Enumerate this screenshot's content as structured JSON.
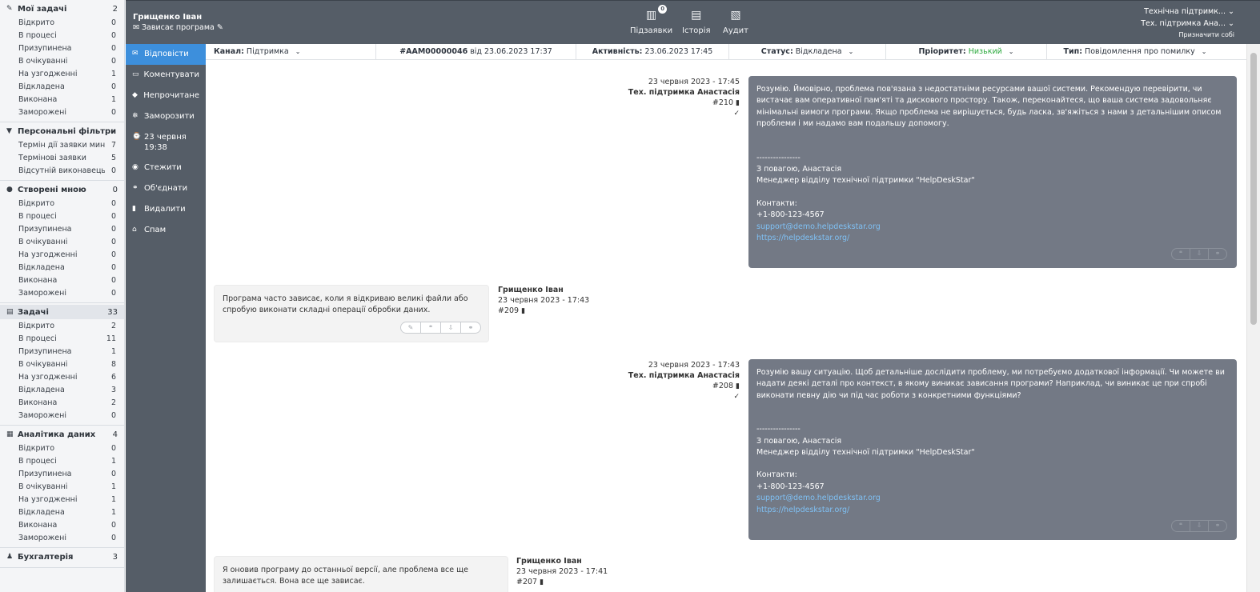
{
  "sidebar": {
    "groups": [
      {
        "icon": "✎",
        "icon_name": "bookmark-icon",
        "title": "Мої задачі",
        "count": "2",
        "active": false,
        "rows": [
          {
            "label": "Відкрито",
            "count": "0"
          },
          {
            "label": "В процесі",
            "count": "0"
          },
          {
            "label": "Призупинена",
            "count": "0"
          },
          {
            "label": "В очікуванні",
            "count": "0"
          },
          {
            "label": "На узгодженні",
            "count": "1"
          },
          {
            "label": "Відкладена",
            "count": "0"
          },
          {
            "label": "Виконана",
            "count": "1"
          },
          {
            "label": "Заморожені",
            "count": "0"
          }
        ]
      },
      {
        "icon": "▼",
        "icon_name": "filter-icon",
        "title": "Персональні фільтри",
        "count": "",
        "active": false,
        "rows": [
          {
            "label": "Термін дії заявки минув",
            "count": "7"
          },
          {
            "label": "Термінові заявки",
            "count": "5"
          },
          {
            "label": "Відсутній виконавець",
            "count": "0"
          }
        ]
      },
      {
        "icon": "●",
        "icon_name": "comment-icon",
        "title": "Створені мною",
        "count": "0",
        "active": false,
        "rows": [
          {
            "label": "Відкрито",
            "count": "0"
          },
          {
            "label": "В процесі",
            "count": "0"
          },
          {
            "label": "Призупинена",
            "count": "0"
          },
          {
            "label": "В очікуванні",
            "count": "0"
          },
          {
            "label": "На узгодженні",
            "count": "0"
          },
          {
            "label": "Відкладена",
            "count": "0"
          },
          {
            "label": "Виконана",
            "count": "0"
          },
          {
            "label": "Заморожені",
            "count": "0"
          }
        ]
      },
      {
        "icon": "▤",
        "icon_name": "clipboard-icon",
        "title": "Задачі",
        "count": "33",
        "active": true,
        "rows": [
          {
            "label": "Відкрито",
            "count": "2"
          },
          {
            "label": "В процесі",
            "count": "11"
          },
          {
            "label": "Призупинена",
            "count": "1"
          },
          {
            "label": "В очікуванні",
            "count": "8"
          },
          {
            "label": "На узгодженні",
            "count": "6"
          },
          {
            "label": "Відкладена",
            "count": "3"
          },
          {
            "label": "Виконана",
            "count": "2"
          },
          {
            "label": "Заморожені",
            "count": "0"
          }
        ]
      },
      {
        "icon": "▦",
        "icon_name": "android-icon",
        "title": "Аналітика даних",
        "count": "4",
        "active": false,
        "rows": [
          {
            "label": "Відкрито",
            "count": "0"
          },
          {
            "label": "В процесі",
            "count": "1"
          },
          {
            "label": "Призупинена",
            "count": "0"
          },
          {
            "label": "В очікуванні",
            "count": "1"
          },
          {
            "label": "На узгодженні",
            "count": "1"
          },
          {
            "label": "Відкладена",
            "count": "1"
          },
          {
            "label": "Виконана",
            "count": "0"
          },
          {
            "label": "Заморожені",
            "count": "0"
          }
        ]
      },
      {
        "icon": "♟",
        "icon_name": "accounting-icon",
        "title": "Бухгалтерія",
        "count": "3",
        "active": false,
        "rows": []
      }
    ]
  },
  "header": {
    "requester": "Грищенко Іван",
    "subject": "Зависає програма",
    "buttons": [
      {
        "label": "Підзаявки",
        "icon": "▥",
        "badge": "0"
      },
      {
        "label": "Історія",
        "icon": "▤",
        "badge": ""
      },
      {
        "label": "Аудит",
        "icon": "▧",
        "badge": ""
      }
    ],
    "group_select": "Технічна підтримк...",
    "assignee_select": "Тех. підтримка Ана...",
    "assign_self": "Призначити собі"
  },
  "actions": [
    {
      "label": "Відповісти",
      "icon": "✉",
      "icon_name": "reply-icon",
      "selected": true
    },
    {
      "label": "Коментувати",
      "icon": "▭",
      "icon_name": "comment-icon",
      "selected": false
    },
    {
      "label": "Непрочитане",
      "icon": "◆",
      "icon_name": "unread-icon",
      "selected": false
    },
    {
      "label": "Заморозити",
      "icon": "❄",
      "icon_name": "snowflake-icon",
      "selected": false
    },
    {
      "label": "23 червня 19:38",
      "icon": "⌚",
      "icon_name": "snooze-icon",
      "selected": false
    },
    {
      "label": "Стежити",
      "icon": "◉",
      "icon_name": "eye-icon",
      "selected": false
    },
    {
      "label": "Об'єднати",
      "icon": "⚭",
      "icon_name": "link-icon",
      "selected": false
    },
    {
      "label": "Видалити",
      "icon": "▮",
      "icon_name": "trash-icon",
      "selected": false
    },
    {
      "label": "Спам",
      "icon": "⌂",
      "icon_name": "spam-icon",
      "selected": false
    }
  ],
  "info": {
    "channel_label": "Канал:",
    "channel_value": "Підтримка",
    "ticket_number": "#AAM00000046",
    "ticket_from": "від 23.06.2023 17:37",
    "activity_label": "Активність:",
    "activity_value": "23.06.2023 17:45",
    "status_label": "Статус:",
    "status_value": "Відкладена",
    "priority_label": "Пріоритет:",
    "priority_value": "Низький",
    "priority_color": "#2eaa3f",
    "type_label": "Тип:",
    "type_value": "Повідомлення про помилку"
  },
  "messages": [
    {
      "agent_time": "23 червня 2023 - 17:45",
      "agent_name": "Тех. підтримка Анастасія",
      "agent_id": "#210",
      "paragraph": "Розумію. Ймовірно, проблема пов'язана з недостатніми ресурсами вашої системи. Рекомендую перевірити, чи вистачає вам оперативної пам'яті та дискового простору. Також, переконайтеся, що ваша система задовольняє мінімальні вимоги програми. Якщо проблема не вирішується, будь ласка, зв'яжіться з нами з детальнішим описом проблеми і ми надамо вам подальшу допомогу.",
      "sep": "----------------",
      "regards": "З повагою, Анастасія",
      "position": "Менеджер відділу технічної підтримки \"HelpDeskStar\"",
      "contacts": "Контакти:",
      "phone": "+1-800-123-4567",
      "email": "support@demo.helpdeskstar.org",
      "site": "https://helpdeskstar.org/"
    },
    {
      "client_text": "Програма часто зависає, коли я відкриваю великі файли або спробую виконати складні операції обробки даних.",
      "client_name": "Грищенко Іван",
      "client_time": "23 червня 2023 - 17:43",
      "client_id": "#209"
    },
    {
      "agent_time": "23 червня 2023 - 17:43",
      "agent_name": "Тех. підтримка Анастасія",
      "agent_id": "#208",
      "paragraph": "Розумію вашу ситуацію. Щоб детальніше дослідити проблему, ми потребуємо додаткової інформації. Чи можете ви надати деякі деталі про контекст, в якому виникає зависання програми? Наприклад, чи виникає це при спробі виконати певну дію чи під час роботи з конкретними функціями?",
      "sep": "----------------",
      "regards": "З повагою, Анастасія",
      "position": "Менеджер відділу технічної підтримки \"HelpDeskStar\"",
      "contacts": "Контакти:",
      "phone": "+1-800-123-4567",
      "email": "support@demo.helpdeskstar.org",
      "site": "https://helpdeskstar.org/"
    },
    {
      "client_text": "Я оновив програму до останньої версії, але проблема все ще залишається. Вона все ще зависає.",
      "client_name": "Грищенко Іван",
      "client_time": "23 червня 2023 - 17:41",
      "client_id": "#207"
    }
  ]
}
